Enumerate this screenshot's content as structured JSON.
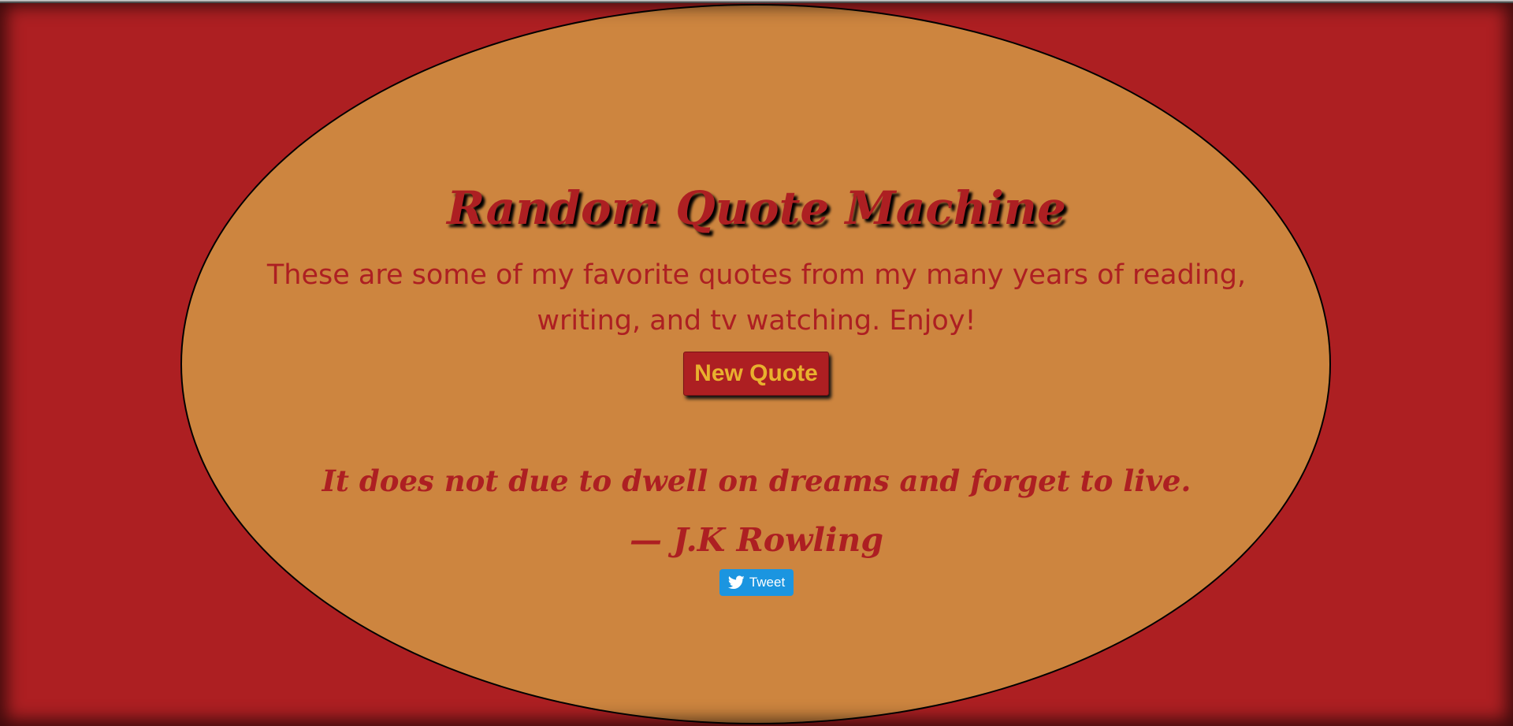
{
  "page": {
    "title": "Random Quote Machine",
    "subtitle": "These are some of my favorite quotes from my many years of reading, writing, and tv watching. Enjoy!"
  },
  "actions": {
    "new_quote_label": "New Quote",
    "tweet_label": "Tweet",
    "tweet_icon": "twitter-bird-icon"
  },
  "quote": {
    "text": "It does not due to dwell on dreams and forget to live.",
    "author": "— J.K Rowling"
  },
  "colors": {
    "background": "#ad1f22",
    "oval": "#cd853f",
    "accent_text": "#ad1f22",
    "button_text": "#e8b12e",
    "tweet_button": "#1b95e0"
  }
}
